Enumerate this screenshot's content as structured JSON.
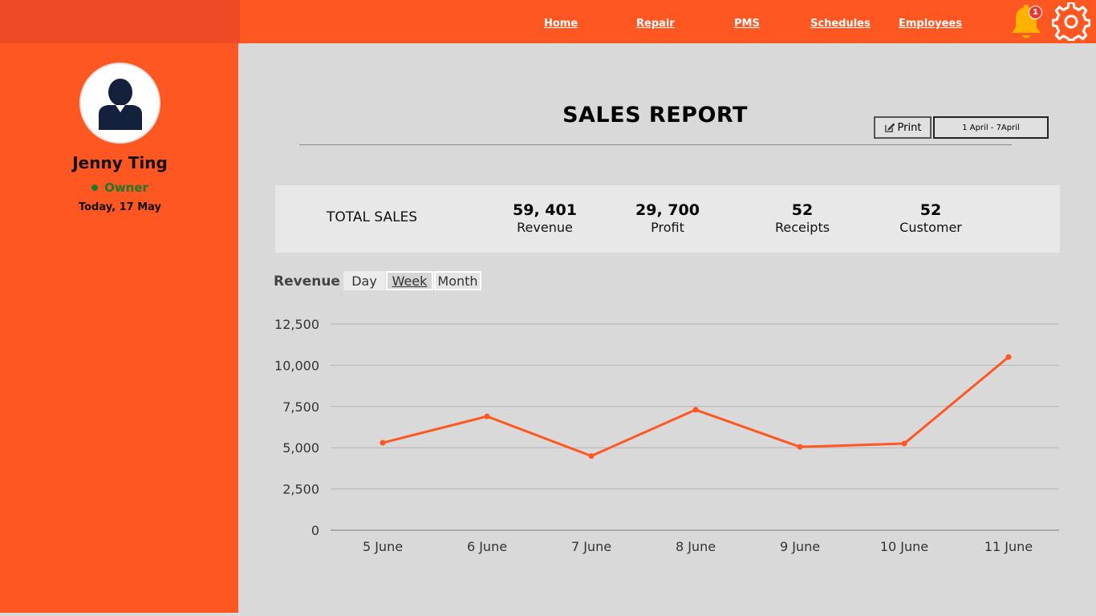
{
  "nav": {
    "links": [
      "Home",
      "Repair",
      "PMS",
      "Schedules",
      "Employees"
    ],
    "notification_count": "1",
    "icons": {
      "bell": "bell-icon",
      "settings": "gear-icon"
    }
  },
  "user": {
    "name": "Jenny Ting",
    "role": "Owner",
    "date": "Today, 17 May"
  },
  "report": {
    "title": "SALES REPORT",
    "print_label": "Print",
    "date_range": "1 April - 7April"
  },
  "summary": {
    "label": "TOTAL SALES",
    "stats": [
      {
        "value": "59, 401",
        "label": "Revenue"
      },
      {
        "value": "29, 700",
        "label": "Profit"
      },
      {
        "value": "52",
        "label": "Receipts"
      },
      {
        "value": "52",
        "label": "Customer"
      }
    ]
  },
  "revenue": {
    "label": "Revenue",
    "periods": [
      "Day",
      "Week",
      "Month"
    ],
    "selected_period": "Week"
  },
  "colors": {
    "accent": "#ff5722",
    "topbar_left": "#ef4a26",
    "bell": "#ffb300",
    "status": "#1b7a2a",
    "background": "#d9d9d9"
  },
  "chart_data": {
    "type": "line",
    "x": [
      "5 June",
      "6 June",
      "7 June",
      "8 June",
      "9 June",
      "10 June",
      "11 June"
    ],
    "series": [
      {
        "values": [
          5300,
          6900,
          4500,
          7300,
          5050,
          5250,
          10500
        ]
      }
    ],
    "yticks": [
      "0",
      "2,500",
      "5,000",
      "7,500",
      "10,000",
      "12,500"
    ],
    "ylim": [
      0,
      12500
    ],
    "grid": true,
    "color": "#ff5722"
  }
}
